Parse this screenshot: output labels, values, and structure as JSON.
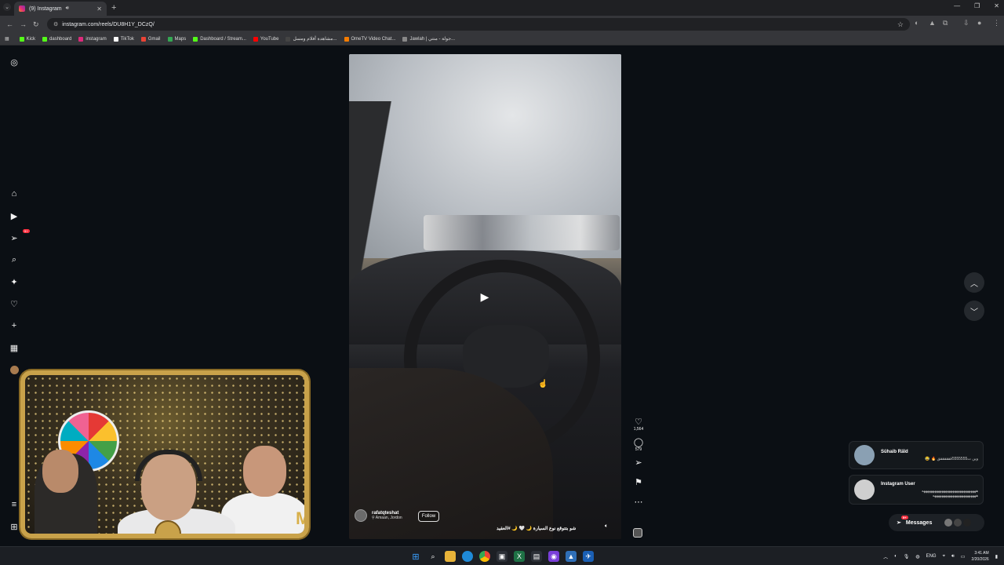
{
  "browser": {
    "tab_title": "(9) Instagram",
    "url": "instagram.com/reels/DU8H1Y_DCzQ/",
    "bookmarks": [
      {
        "label": "Kick",
        "color": "#53fc18"
      },
      {
        "label": "dashboard",
        "color": "#53fc18"
      },
      {
        "label": "instagram",
        "color": "#dd2a7b"
      },
      {
        "label": "TikTok",
        "color": "#ffffff"
      },
      {
        "label": "Gmail",
        "color": "#ea4335"
      },
      {
        "label": "Maps",
        "color": "#34a853"
      },
      {
        "label": "Dashboard / Stream...",
        "color": "#53fc18"
      },
      {
        "label": "YouTube",
        "color": "#ff0000"
      },
      {
        "label": "مشاهدة أفلام ومسل...",
        "color": "#444444"
      },
      {
        "label": "OmeTV Video Chat...",
        "color": "#f57c00"
      },
      {
        "label": "Jawlah | جولة - منتي...",
        "color": "#888888"
      }
    ]
  },
  "sidebar": {
    "items": [
      {
        "name": "instagram-logo-icon",
        "glyph": "◎"
      },
      {
        "name": "home-icon",
        "glyph": "⌂"
      },
      {
        "name": "reels-icon",
        "glyph": "▶"
      },
      {
        "name": "send-icon",
        "glyph": "➢"
      },
      {
        "name": "search-icon",
        "glyph": "⌕"
      },
      {
        "name": "explore-icon",
        "glyph": "✦"
      },
      {
        "name": "heart-icon",
        "glyph": "♡"
      },
      {
        "name": "create-icon",
        "glyph": "+"
      },
      {
        "name": "dashboard-icon",
        "glyph": "▦"
      },
      {
        "name": "profile-avatar",
        "glyph": "●"
      },
      {
        "name": "menu-icon",
        "glyph": "≡"
      },
      {
        "name": "more-icon",
        "glyph": "⊞"
      }
    ],
    "messages_badge": "9+"
  },
  "reel": {
    "author": "rafatqteshat",
    "location": "Amaan, Jordon",
    "follow_label": "Follow",
    "caption": "شو بتتوقع نوع السيارة 🌙 🤍 🌙 #العقيد",
    "likes": "1,564",
    "comments": "579"
  },
  "notifications": [
    {
      "name": "Sühaib Räïd",
      "text": "وين ت5555555ققققققق 🔥 😂"
    },
    {
      "name": "Instagram User",
      "text": "ههههههههههههههههههههههههههههههه ههههههههههههههههههههههههه"
    }
  ],
  "messages": {
    "label": "Messages",
    "badge": "9+"
  },
  "taskbar": {
    "lang": "ENG",
    "time": "3:41 AM",
    "date": "2/20/2026"
  }
}
